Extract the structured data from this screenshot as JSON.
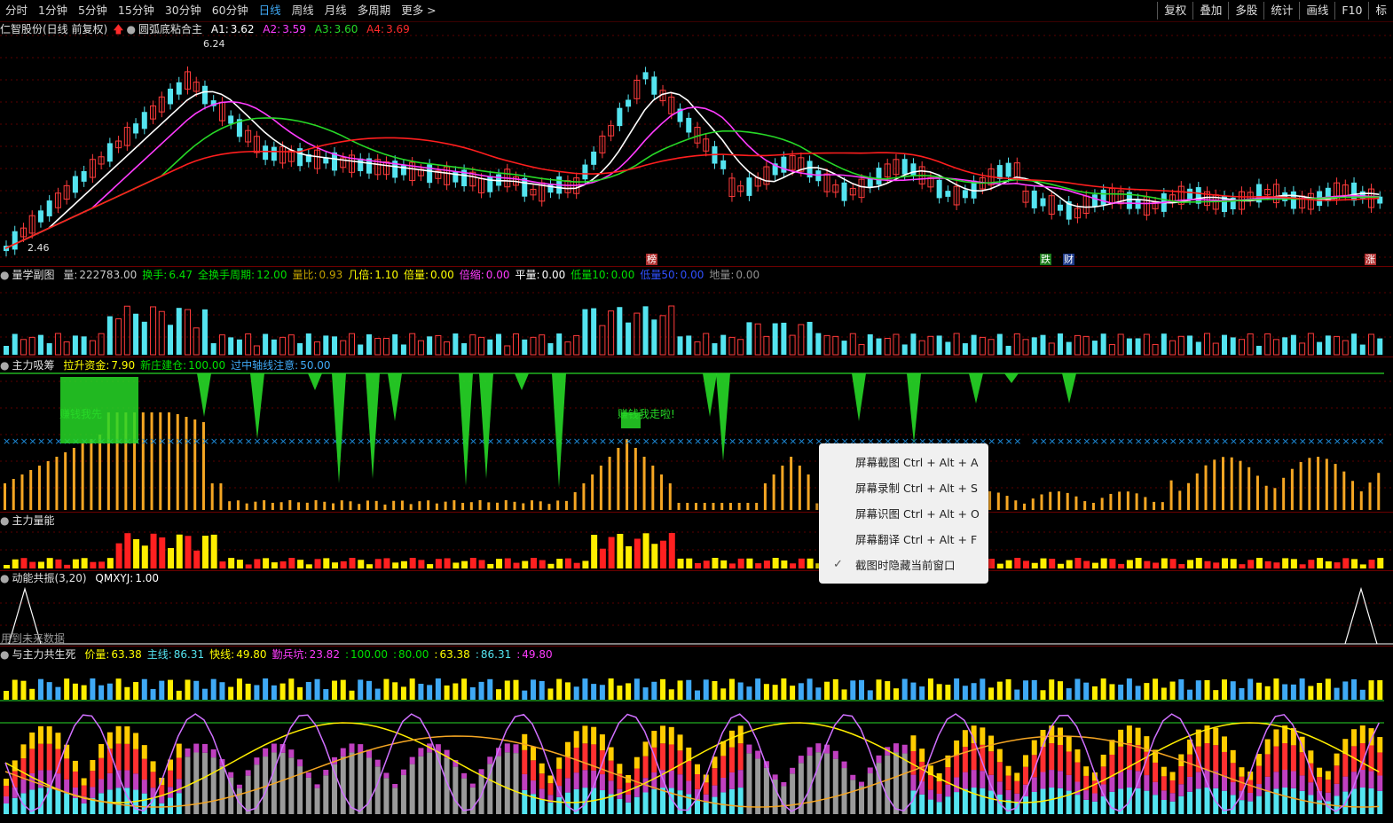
{
  "toolbar": {
    "timeframes": [
      "分时",
      "1分钟",
      "5分钟",
      "15分钟",
      "30分钟",
      "60分钟",
      "日线",
      "周线",
      "月线",
      "多周期",
      "更多 >"
    ],
    "active_timeframe": "日线",
    "right_tools": [
      "复权",
      "叠加",
      "多股",
      "统计",
      "画线",
      "F10",
      "标"
    ]
  },
  "main": {
    "stock_title": "仁智股份(日线 前复权)",
    "indicator": "圆弧底粘合主",
    "a1_label": "A1:",
    "a1": "3.62",
    "a2_label": "A2:",
    "a2": "3.59",
    "a3_label": "A3:",
    "a3": "3.60",
    "a4_label": "A4:",
    "a4": "3.69",
    "high_label": "6.24",
    "low_label": "2.46",
    "tag_bang": "榜",
    "tag_die": "跌",
    "tag_cai": "财",
    "tag_zhang": "涨",
    "colors": {
      "up": "#ff3b3b",
      "down": "#54e4f0",
      "ma_white": "#ffffff",
      "ma_magenta": "#ff3cff",
      "ma_green": "#27d827",
      "ma_red": "#ff1e1e"
    }
  },
  "volume": {
    "title": "量学副图",
    "items": [
      {
        "label": "量:",
        "value": "222783.00",
        "color": "#c8c8c8"
      },
      {
        "label": "换手:",
        "value": "6.47",
        "color": "#00e000"
      },
      {
        "label": "全换手周期:",
        "value": "12.00",
        "color": "#00e000"
      },
      {
        "label": "量比:",
        "value": "0.93",
        "color": "#c0a000"
      },
      {
        "label": "几倍:",
        "value": "1.10",
        "color": "#ffff00"
      },
      {
        "label": "倍量:",
        "value": "0.00",
        "color": "#ffff00"
      },
      {
        "label": "倍缩:",
        "value": "0.00",
        "color": "#ff3cff"
      },
      {
        "label": "平量:",
        "value": "0.00",
        "color": "#ffffff"
      },
      {
        "label": "低量10:",
        "value": "0.00",
        "color": "#00e000"
      },
      {
        "label": "低量50:",
        "value": "0.00",
        "color": "#3050ff"
      },
      {
        "label": "地量:",
        "value": "0.00",
        "color": "#909090"
      }
    ]
  },
  "accum": {
    "title": "主力吸筹",
    "items": [
      {
        "label": "拉升资金:",
        "value": "7.90",
        "color": "#ffff00"
      },
      {
        "label": "新庄建仓:",
        "value": "100.00",
        "color": "#00e000"
      },
      {
        "label": "过中轴线注意:",
        "value": "50.00",
        "color": "#3fa9f5"
      }
    ],
    "note1": "赚钱我先",
    "note2": "赚钱我走啦!"
  },
  "energy": {
    "title": "主力量能"
  },
  "resonance": {
    "title": "动能共振(3,20)",
    "item_label": "QMXYJ:",
    "item_value": "1.00",
    "future_note": "用到未来数据"
  },
  "lifeDeath": {
    "title": "与主力共生死",
    "items": [
      {
        "label": "价量:",
        "value": "63.38",
        "color": "#ffff00"
      },
      {
        "label": "主线:",
        "value": "86.31",
        "color": "#54e4f0"
      },
      {
        "label": "快线:",
        "value": "49.80",
        "color": "#ffff00"
      },
      {
        "label": "勤兵坑:",
        "value": "23.82",
        "color": "#ff3cff"
      },
      {
        "label": ":",
        "value": "100.00",
        "color": "#00e000"
      },
      {
        "label": ":",
        "value": "80.00",
        "color": "#00e000"
      },
      {
        "label": ":",
        "value": "63.38",
        "color": "#ffff00"
      },
      {
        "label": ":",
        "value": "86.31",
        "color": "#54e4f0"
      },
      {
        "label": ":",
        "value": "49.80",
        "color": "#ff3cff"
      }
    ]
  },
  "context_menu": {
    "items": [
      {
        "label": "屏幕截图 Ctrl + Alt + A",
        "checked": false
      },
      {
        "label": "屏幕录制 Ctrl + Alt + S",
        "checked": false
      },
      {
        "label": "屏幕识图 Ctrl + Alt + O",
        "checked": false
      },
      {
        "label": "屏幕翻译 Ctrl + Alt + F",
        "checked": false
      },
      {
        "label": "截图时隐藏当前窗口",
        "checked": true
      }
    ],
    "check_glyph": "✓"
  }
}
